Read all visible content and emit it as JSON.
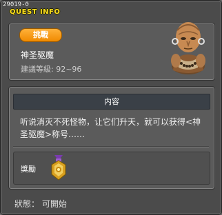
{
  "window": {
    "quest_id": "29019-0",
    "title": "QUEST INFO"
  },
  "quest": {
    "badge": "挑戰",
    "name": "神圣驱魔",
    "level": "建議等級: 92~96"
  },
  "content": {
    "header": "内容",
    "description": "听说消灭不死怪物，让它们升天，就可以获得<神圣驱魔>称号……"
  },
  "reward": {
    "label": "獎勵",
    "item_icon": "medal-icon"
  },
  "status": {
    "text": "狀態： 可開始"
  },
  "colors": {
    "title": "#ffe020",
    "badge": "#f39a1a",
    "background": "#4b4b4b"
  }
}
